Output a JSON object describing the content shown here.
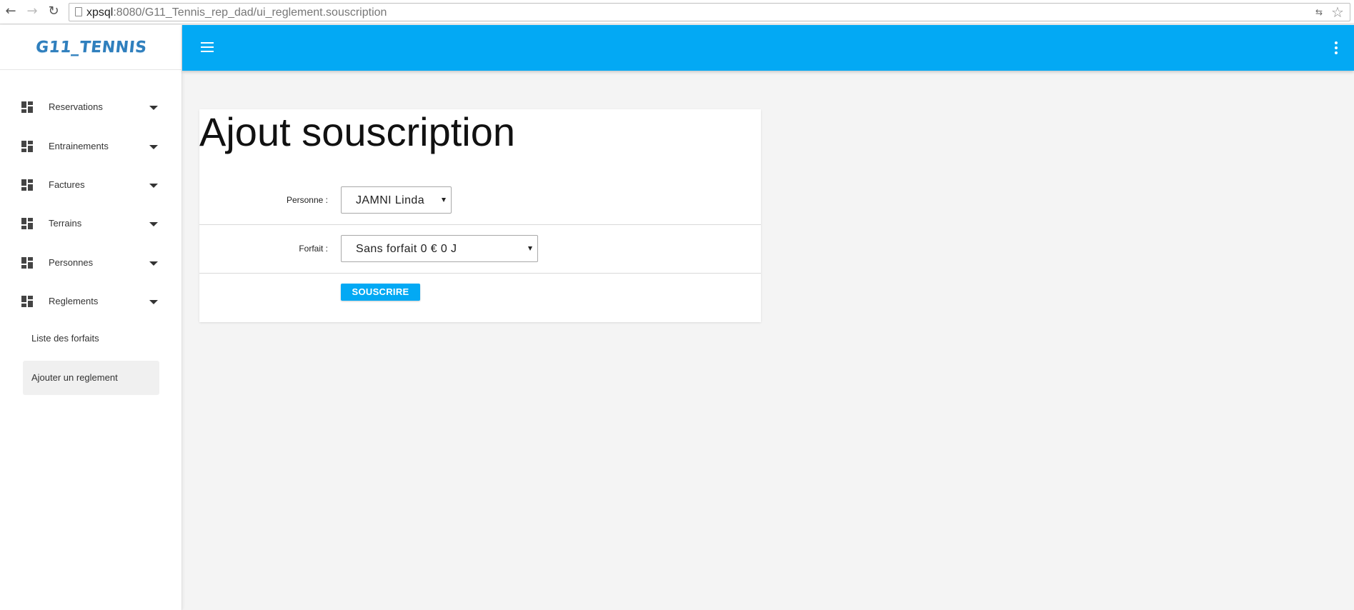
{
  "browser": {
    "url_host": "xpsql",
    "url_rest": ":8080/G11_Tennis_rep_dad/ui_reglement.souscription"
  },
  "sidebar": {
    "logo": "G11_TENNIS",
    "items": [
      {
        "label": "Reservations"
      },
      {
        "label": "Entrainements"
      },
      {
        "label": "Factures"
      },
      {
        "label": "Terrains"
      },
      {
        "label": "Personnes"
      },
      {
        "label": "Reglements"
      }
    ],
    "subitems": [
      {
        "label": "Liste des forfaits"
      },
      {
        "label": "Ajouter un reglement"
      }
    ]
  },
  "form": {
    "title": "Ajout souscription",
    "personne_label": "Personne :",
    "personne_value": "JAMNI Linda",
    "forfait_label": "Forfait :",
    "forfait_value": "Sans forfait 0 € 0 J",
    "submit_label": "SOUSCRIRE"
  },
  "colors": {
    "accent": "#03a9f4",
    "logo": "#2f7fbd"
  },
  "icons": [
    "back-arrow-icon",
    "forward-arrow-icon",
    "reload-icon",
    "page-icon",
    "translate-icon",
    "star-icon",
    "dashboard-icon",
    "caret-down-icon",
    "hamburger-menu-icon",
    "more-vert-icon"
  ]
}
